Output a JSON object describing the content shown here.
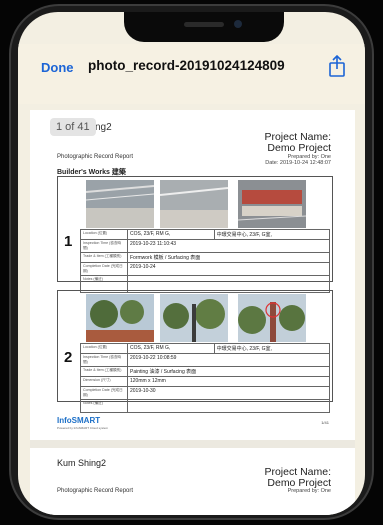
{
  "nav": {
    "done_label": "Done",
    "title": "photo_record-20191024124809"
  },
  "viewer": {
    "page_counter": "1 of 41",
    "header_cut": "ng2"
  },
  "report": {
    "project_label": "Project Name:",
    "project_name": "Demo Project",
    "prepared_by": "Prepared by: One",
    "date": "Date: 2019-10-24 12:48:07",
    "report_title": "Photographic Record Report",
    "section": "Builder's Works 建築",
    "labels": [
      "Location (位置)",
      "Inspection Time (檢查時間)",
      "Trade & Item (工種類別)",
      "Dimension (尺寸)",
      "Completion Date (完成日期)",
      "Notes (備註)"
    ]
  },
  "records": [
    {
      "number": "1",
      "location": "COS, 23/F, RM G,",
      "location_cn": "中環交易中心, 23/F, G室,",
      "time": "2019-10-23 11:10:43",
      "trade": "Formwork 模板 / Surfacing 表面",
      "completion": "2019-10-24"
    },
    {
      "number": "2",
      "location": "COS, 23/F, RM G,",
      "location_cn": "中環交易中心, 23/F, G室,",
      "time": "2019-10-22 10:08:59",
      "trade": "Painting 油漆 / Surfacing 表面",
      "dimension": "120mm x 12mm",
      "completion": "2019-10-30"
    }
  ],
  "footer": {
    "brand": "InfoSMART",
    "brand_sub": "Powered by InfoSMART Cloud system",
    "page": "1/41"
  },
  "page2": {
    "name": "Kum Shing2",
    "project_label": "Project Name:",
    "project_name": "Demo Project",
    "report_title": "Photographic Record Report",
    "prepared_by": "Prepared by: One"
  },
  "colors": {
    "accent": "#1b64d6"
  }
}
